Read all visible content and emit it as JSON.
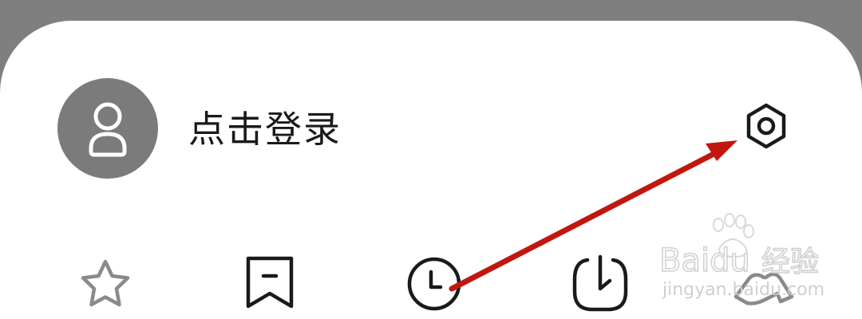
{
  "profile": {
    "login_label": "点击登录"
  },
  "icons": {
    "avatar": "user-icon",
    "settings": "gear-icon",
    "favorites": "star-icon",
    "bookmarks": "bookmark-icon",
    "history": "clock-icon",
    "downloads": "download-icon",
    "skin": "clothes-icon"
  },
  "watermark": {
    "brand": "Baidu",
    "brand_cn": "经验",
    "url": "jingyan.baidu.com"
  },
  "colors": {
    "backdrop": "#7f7f7f",
    "avatar_bg": "#7b7b7b",
    "arrow": "#c0170f"
  }
}
